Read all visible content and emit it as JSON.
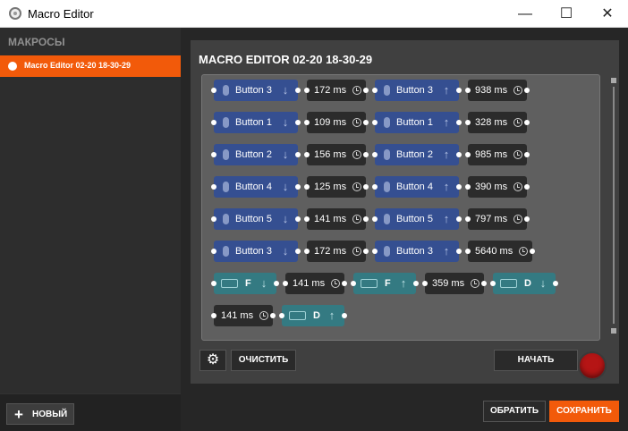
{
  "window": {
    "title": "Macro Editor",
    "minimize": "—",
    "maximize": "☐",
    "close": "✕"
  },
  "sidebar": {
    "header": "МАКРОСЫ",
    "items": [
      {
        "label": "Macro Editor 02-20 18-30-29"
      }
    ],
    "new_button": "НОВЫЙ",
    "new_icon": "plus-icon"
  },
  "editor": {
    "title": "MACRO EDITOR 02-20 18-30-29",
    "steps": [
      {
        "type": "mouse",
        "label": "Button 3",
        "direction": "down"
      },
      {
        "type": "delay",
        "label": "172 ms"
      },
      {
        "type": "mouse",
        "label": "Button 3",
        "direction": "up"
      },
      {
        "type": "delay",
        "label": "938 ms"
      },
      {
        "type": "mouse",
        "label": "Button 1",
        "direction": "down"
      },
      {
        "type": "delay",
        "label": "109 ms"
      },
      {
        "type": "mouse",
        "label": "Button 1",
        "direction": "up"
      },
      {
        "type": "delay",
        "label": "328 ms"
      },
      {
        "type": "mouse",
        "label": "Button 2",
        "direction": "down"
      },
      {
        "type": "delay",
        "label": "156 ms"
      },
      {
        "type": "mouse",
        "label": "Button 2",
        "direction": "up"
      },
      {
        "type": "delay",
        "label": "985 ms"
      },
      {
        "type": "mouse",
        "label": "Button 4",
        "direction": "down"
      },
      {
        "type": "delay",
        "label": "125 ms"
      },
      {
        "type": "mouse",
        "label": "Button 4",
        "direction": "up"
      },
      {
        "type": "delay",
        "label": "390 ms"
      },
      {
        "type": "mouse",
        "label": "Button 5",
        "direction": "down"
      },
      {
        "type": "delay",
        "label": "141 ms"
      },
      {
        "type": "mouse",
        "label": "Button 5",
        "direction": "up"
      },
      {
        "type": "delay",
        "label": "797 ms"
      },
      {
        "type": "mouse",
        "label": "Button 3",
        "direction": "down"
      },
      {
        "type": "delay",
        "label": "172 ms"
      },
      {
        "type": "mouse",
        "label": "Button 3",
        "direction": "up"
      },
      {
        "type": "delay",
        "label": "5640 ms"
      },
      {
        "type": "key",
        "label": "F",
        "direction": "down"
      },
      {
        "type": "delay",
        "label": "141 ms"
      },
      {
        "type": "key",
        "label": "F",
        "direction": "up"
      },
      {
        "type": "delay",
        "label": "359 ms"
      },
      {
        "type": "key",
        "label": "D",
        "direction": "down"
      },
      {
        "type": "delay",
        "label": "141 ms"
      },
      {
        "type": "key",
        "label": "D",
        "direction": "up"
      }
    ],
    "gear_icon": "gear-icon",
    "clear_button": "ОЧИСТИТЬ",
    "start_button": "НАЧАТЬ",
    "record_icon": "record-icon",
    "restore_button": "ОБРАТИТЬ",
    "save_button": "СОХРАНИТЬ"
  },
  "colors": {
    "accent": "#f25a0a",
    "mouse_block": "#354f91",
    "key_block": "#347a82",
    "delay_block": "#2b2b2b"
  }
}
